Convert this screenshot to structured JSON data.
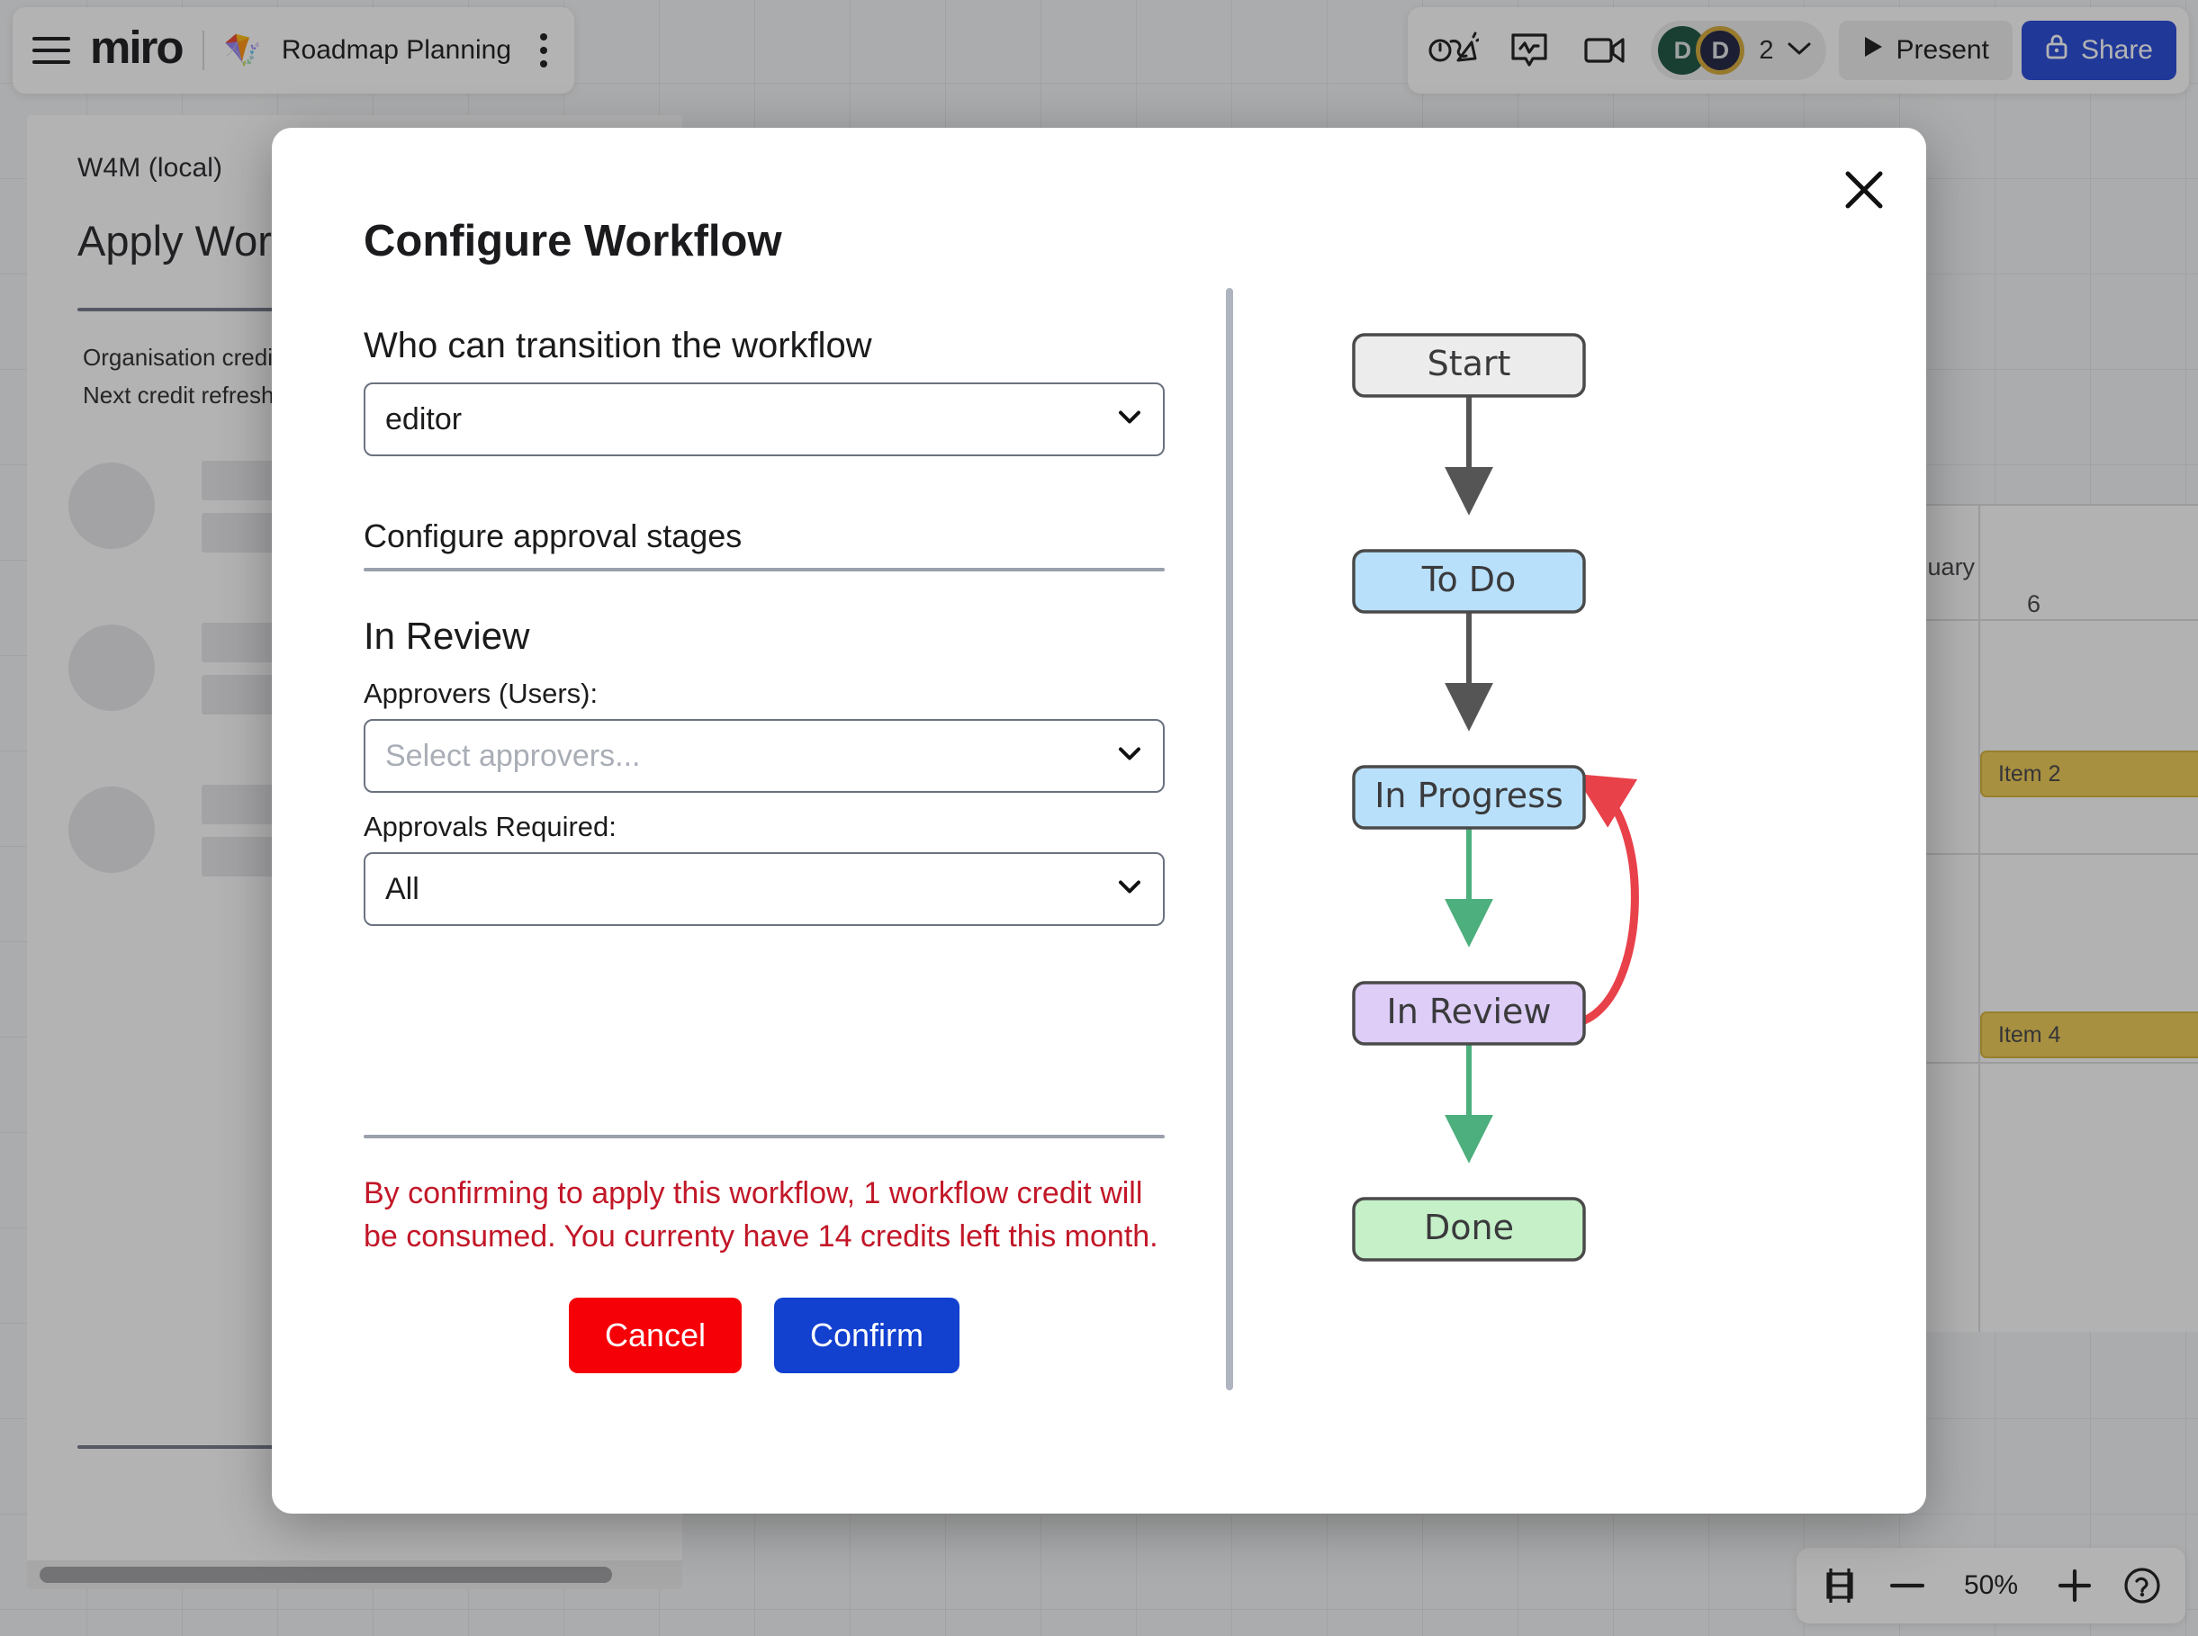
{
  "topbar": {
    "menu_icon": "hamburger-icon",
    "logo": "miro",
    "board_emoji": "🪁",
    "board_name": "Roadmap Planning",
    "kebab_icon": "more-options-icon",
    "celebrate_icon": "reactions-icon",
    "comment_icon": "comment-icon",
    "video_icon": "video-chat-icon",
    "avatar_1_initial": "D",
    "avatar_2_initial": "D",
    "avatar_count": "2",
    "present_label": "Present",
    "present_icon": "play-icon",
    "share_label": "Share",
    "share_icon": "lock-icon",
    "avatar_1_color": "#0d4a35",
    "avatar_2_color": "#141836",
    "avatar_2_ring": "#d4a72c",
    "share_color": "#1a3fd4"
  },
  "left_panel": {
    "org": "W4M (local)",
    "title": "Apply Workflow",
    "credits_line": "Organisation credits",
    "refresh_line": "Next credit refresh"
  },
  "timeline": {
    "month": "January",
    "day": "6",
    "item_2": "Item 2",
    "item_4": "Item 4",
    "bar_color": "#eec84b"
  },
  "zoombar": {
    "fit_icon": "fit-to-screen-icon",
    "minus_icon": "zoom-out-icon",
    "zoom_level": "50%",
    "plus_icon": "zoom-in-icon",
    "help_icon": "help-icon"
  },
  "modal": {
    "title": "Configure Workflow",
    "close_icon": "close-icon",
    "transition_label": "Who can transition the workflow",
    "transition_value": "editor",
    "approval_section": "Configure approval stages",
    "stage_name": "In Review",
    "approvers_label": "Approvers (Users):",
    "approvers_placeholder": "Select approvers...",
    "approvals_required_label": "Approvals Required:",
    "approvals_required_value": "All",
    "warning": "By confirming to apply this workflow, 1 workflow credit will be consumed. You currenty have 14 credits left this month.",
    "cancel_label": "Cancel",
    "confirm_label": "Confirm",
    "warning_color": "#c21728",
    "cancel_color": "#f50007",
    "confirm_color": "#1240cf"
  },
  "flowchart": {
    "nodes": [
      {
        "id": "start",
        "label": "Start",
        "fill": "#ececec",
        "stroke": "#4a4a4a"
      },
      {
        "id": "todo",
        "label": "To Do",
        "fill": "#b9e0fb",
        "stroke": "#4a4a4a"
      },
      {
        "id": "inprogress",
        "label": "In Progress",
        "fill": "#b9e0fb",
        "stroke": "#4a4a4a"
      },
      {
        "id": "inreview",
        "label": "In Review",
        "fill": "#ddcdf7",
        "stroke": "#4a4a4a"
      },
      {
        "id": "done",
        "label": "Done",
        "fill": "#c5f0c8",
        "stroke": "#4a4a4a"
      }
    ],
    "edges": [
      {
        "from": "start",
        "to": "todo",
        "color": "#555555",
        "kind": "straight"
      },
      {
        "from": "todo",
        "to": "inprogress",
        "color": "#555555",
        "kind": "straight"
      },
      {
        "from": "inprogress",
        "to": "inreview",
        "color": "#4caf7d",
        "kind": "straight"
      },
      {
        "from": "inreview",
        "to": "done",
        "color": "#4caf7d",
        "kind": "straight"
      },
      {
        "from": "inreview",
        "to": "inprogress",
        "color": "#e8414a",
        "kind": "curved-reject"
      }
    ]
  }
}
